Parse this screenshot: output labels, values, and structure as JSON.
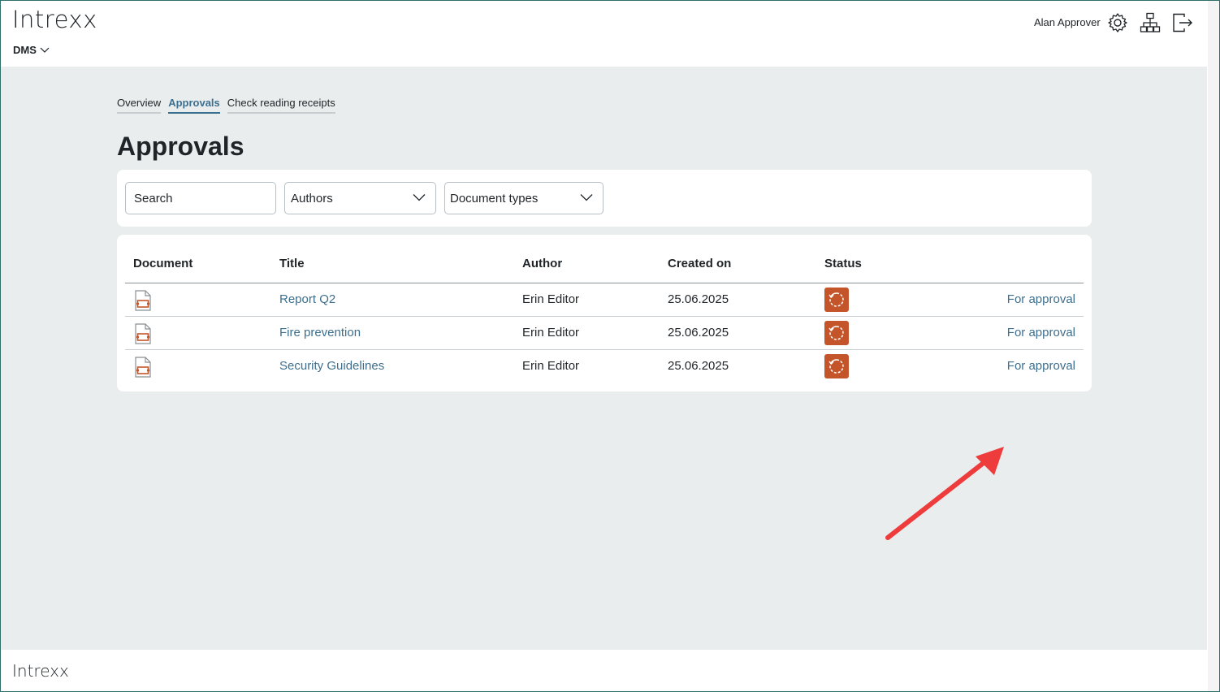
{
  "header": {
    "logo": "Intrexx",
    "app_switch": "DMS",
    "user_name": "Alan Approver",
    "icons": [
      "gear-icon",
      "sitemap-icon",
      "logout-icon"
    ]
  },
  "tabs": [
    {
      "label": "Overview",
      "active": false
    },
    {
      "label": "Approvals",
      "active": true
    },
    {
      "label": "Check reading receipts",
      "active": false
    }
  ],
  "page_title": "Approvals",
  "filters": {
    "search_placeholder": "Search",
    "authors_label": "Authors",
    "document_types_label": "Document types"
  },
  "table": {
    "columns": [
      "Document",
      "Title",
      "Author",
      "Created on",
      "Status"
    ],
    "rows": [
      {
        "document_icon": "pdf-document-icon",
        "title": "Report Q2",
        "author": "Erin Editor",
        "created_on": "25.06.2025",
        "status_icon": "refresh-icon",
        "status": "For approval"
      },
      {
        "document_icon": "pdf-document-icon",
        "title": "Fire prevention",
        "author": "Erin Editor",
        "created_on": "25.06.2025",
        "status_icon": "refresh-icon",
        "status": "For approval"
      },
      {
        "document_icon": "pdf-document-icon",
        "title": "Security Guidelines",
        "author": "Erin Editor",
        "created_on": "25.06.2025",
        "status_icon": "refresh-icon",
        "status": "For approval"
      }
    ]
  },
  "footer": {
    "logo": "Intrexx"
  },
  "colors": {
    "accent_link": "#3d6f8e",
    "status_orange": "#c4552a",
    "background": "#e9edee",
    "annotation_arrow": "#ee3b3b"
  }
}
